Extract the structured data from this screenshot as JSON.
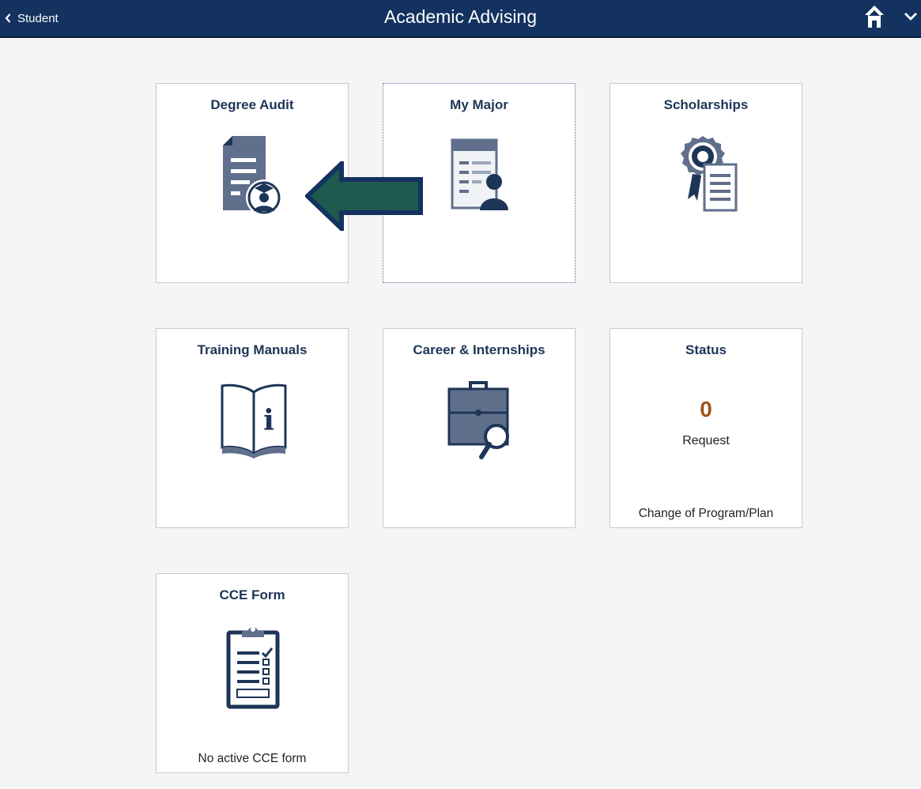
{
  "header": {
    "back_label": "Student",
    "title": "Academic Advising",
    "home_icon": "home-icon",
    "menu_icon": "chevron-down-icon"
  },
  "tiles": [
    {
      "title": "Degree Audit",
      "icon": "degree-audit-icon"
    },
    {
      "title": "My Major",
      "icon": "my-major-icon"
    },
    {
      "title": "Scholarships",
      "icon": "scholarship-award-icon"
    },
    {
      "title": "Training Manuals",
      "icon": "book-info-icon"
    },
    {
      "title": "Career & Internships",
      "icon": "briefcase-search-icon"
    },
    {
      "title": "Status",
      "count": "0",
      "label": "Request",
      "footer": "Change of Program/Plan"
    },
    {
      "title": "CCE Form",
      "icon": "clipboard-checklist-icon",
      "footer": "No active CCE form"
    }
  ],
  "colors": {
    "header_bg": "#133260",
    "icon_primary": "#1d3557",
    "icon_secondary": "#5f6f8c",
    "status_count": "#a0521d",
    "arrow_fill": "#1e5a4e",
    "arrow_stroke": "#133260"
  },
  "annotation": {
    "arrow": "left-pointing-arrow"
  }
}
